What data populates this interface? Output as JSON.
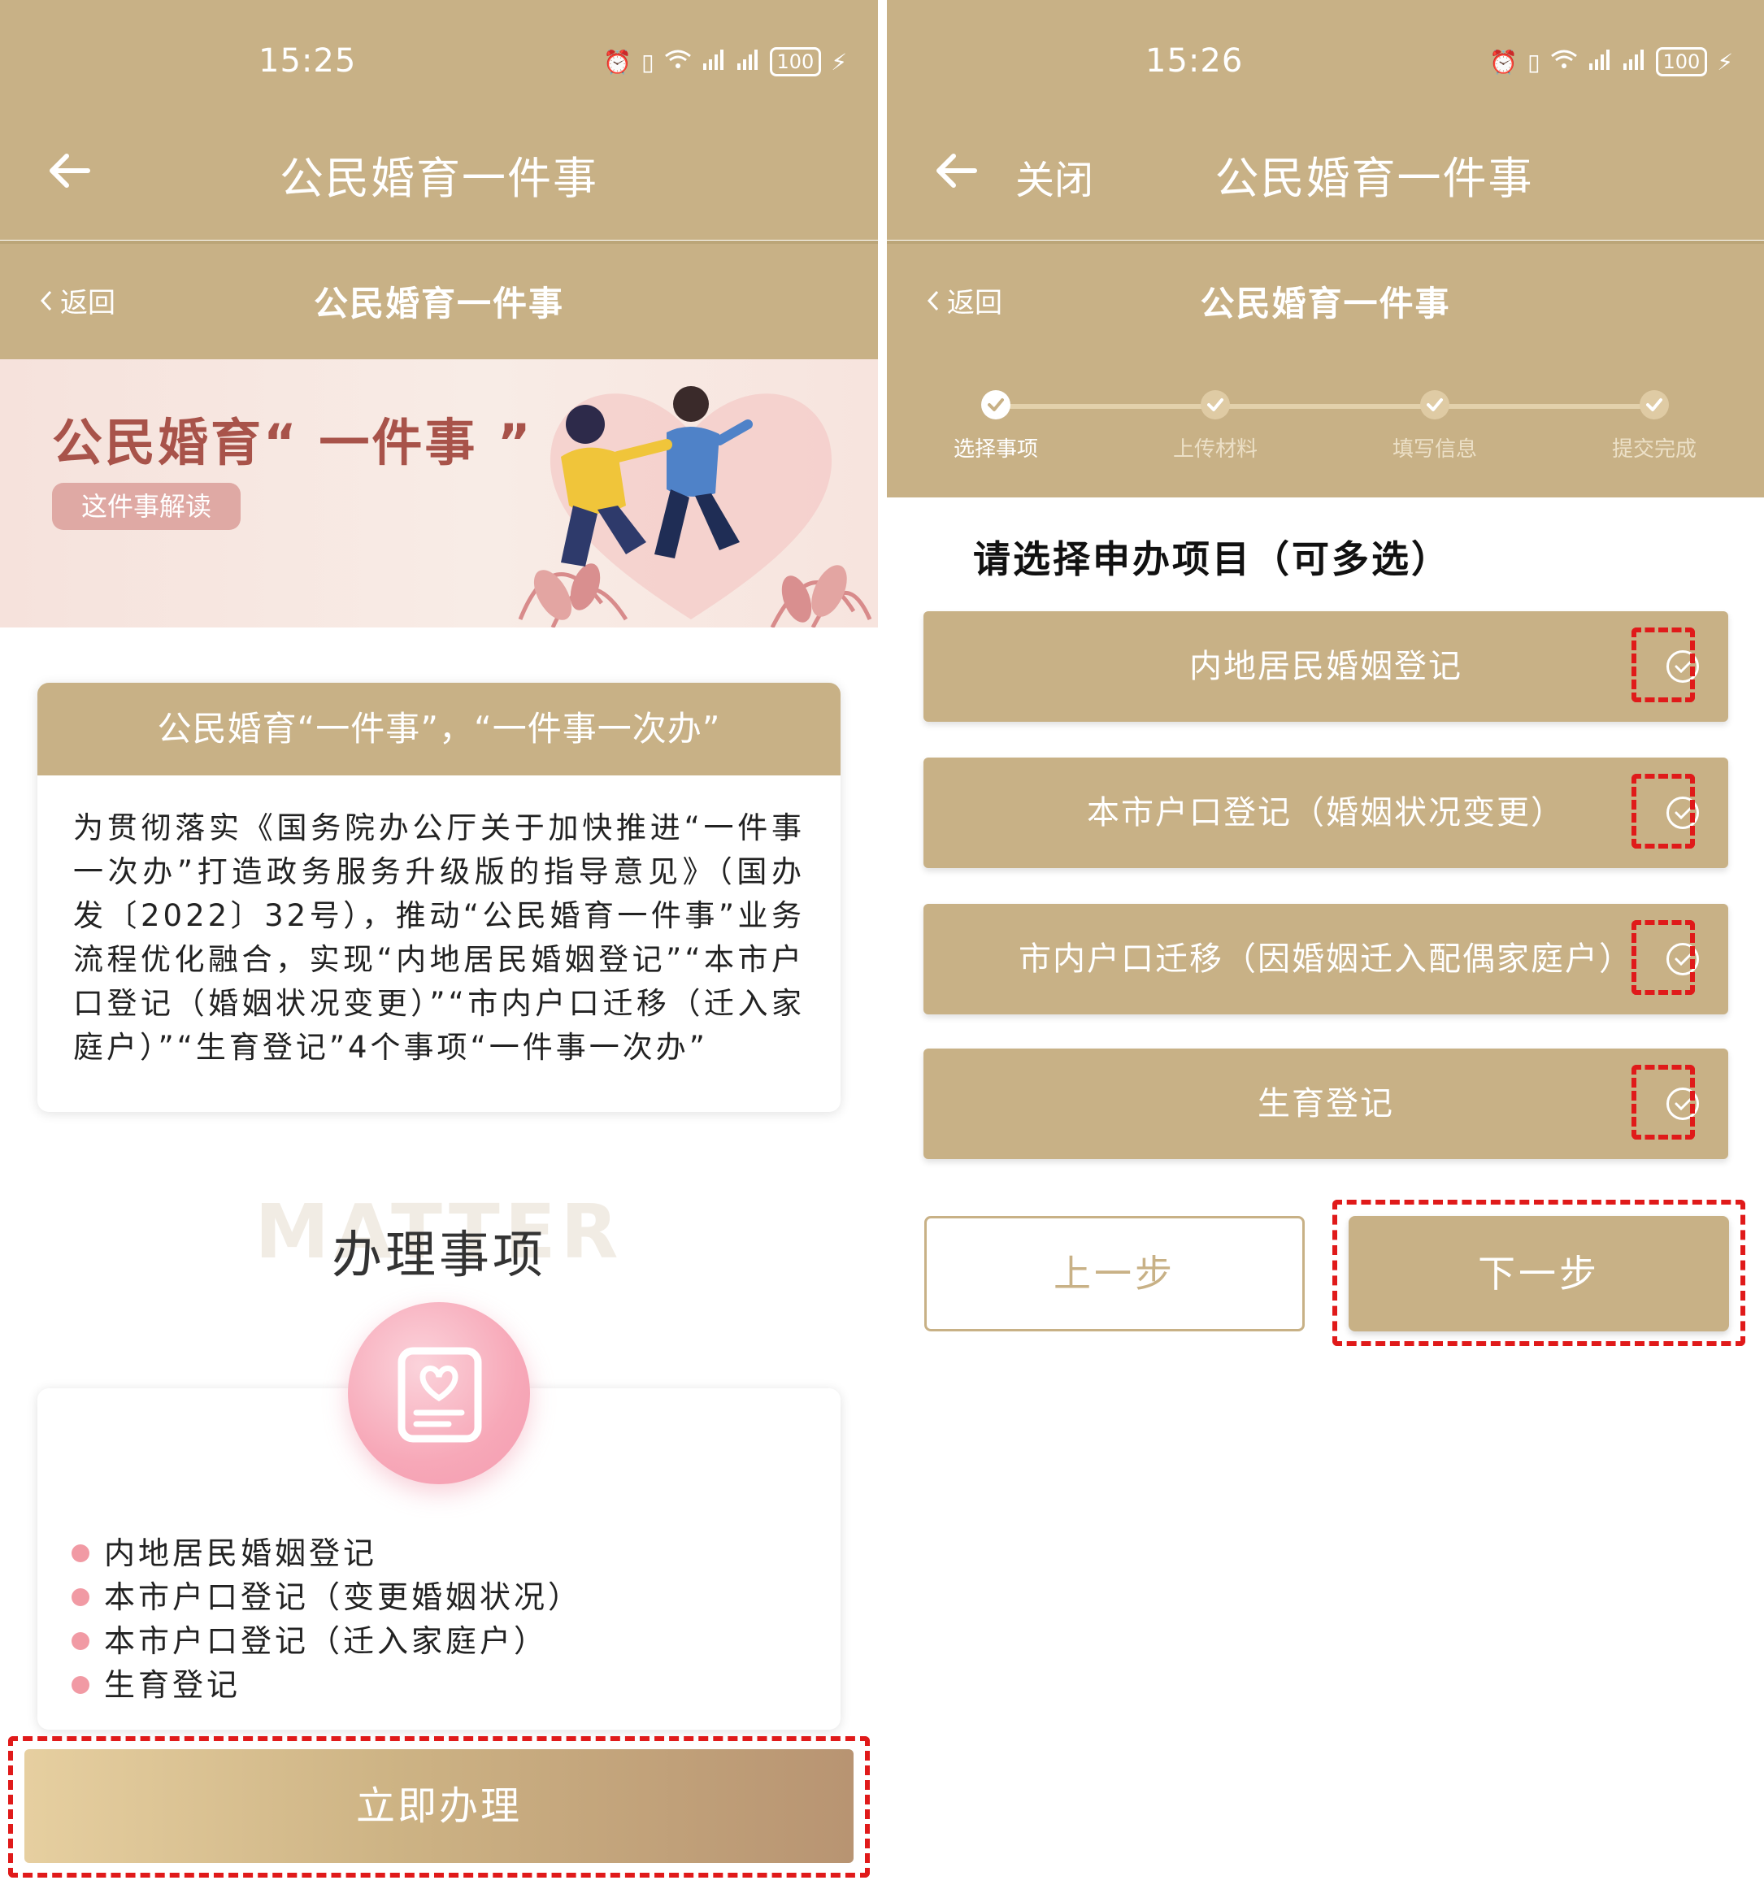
{
  "left": {
    "status": {
      "time": "15:25",
      "battery": "100"
    },
    "appbar": {
      "title": "公民婚育一件事"
    },
    "subbar": {
      "back": "返回",
      "title": "公民婚育一件事"
    },
    "banner": {
      "title": "公民婚育“ 一件事 ”",
      "pill": "这件事解读"
    },
    "intro_card": {
      "header": "公民婚育“一件事”，“一件事一次办”",
      "body": "为贯彻落实《国务院办公厅关于加快推进“一件事一次办”打造政务服务升级版的指导意见》（国办发〔2022〕32号），推动“公民婚育一件事”业务流程优化融合，实现“内地居民婚姻登记”“本市户口登记（婚姻状况变更）”“市内户口迁移（迁入家庭户）”“生育登记”4个事项“一件事一次办”"
    },
    "matters": {
      "watermark": "MATTER",
      "title": "办理事项",
      "items": [
        "内地居民婚姻登记",
        "本市户口登记（变更婚姻状况）",
        "本市户口登记（迁入家庭户）",
        "生育登记"
      ]
    },
    "cta": "立即办理"
  },
  "right": {
    "status": {
      "time": "15:26",
      "battery": "100"
    },
    "appbar": {
      "close": "关闭",
      "title": "公民婚育一件事"
    },
    "subbar": {
      "back": "返回",
      "title": "公民婚育一件事"
    },
    "steps": [
      "选择事项",
      "上传材料",
      "填写信息",
      "提交完成"
    ],
    "current_step": 1,
    "select_title": "请选择申办项目（可多选）",
    "options": [
      "内地居民婚姻登记",
      "本市户口登记（婚姻状况变更）",
      "市内户口迁移（因婚姻迁入配偶家庭户）",
      "生育登记"
    ],
    "prev_button": "上一步",
    "next_button": "下一步"
  },
  "colors": {
    "brand": "#c8b186",
    "highlight": "#e01a1a",
    "bullet": "#f19aa4",
    "banner_title": "#a8534a"
  }
}
